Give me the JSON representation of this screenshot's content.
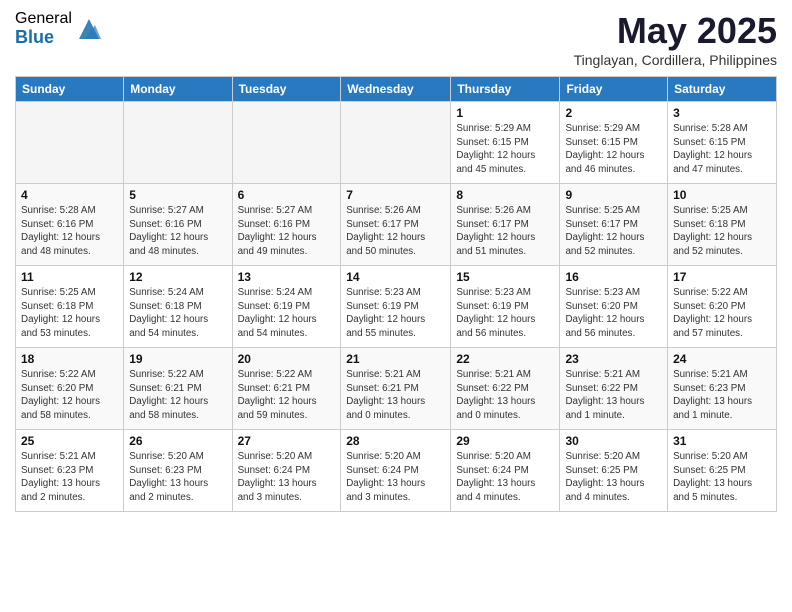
{
  "logo": {
    "general": "General",
    "blue": "Blue"
  },
  "header": {
    "month_year": "May 2025",
    "location": "Tinglayan, Cordillera, Philippines"
  },
  "weekdays": [
    "Sunday",
    "Monday",
    "Tuesday",
    "Wednesday",
    "Thursday",
    "Friday",
    "Saturday"
  ],
  "weeks": [
    [
      {
        "day": "",
        "info": ""
      },
      {
        "day": "",
        "info": ""
      },
      {
        "day": "",
        "info": ""
      },
      {
        "day": "",
        "info": ""
      },
      {
        "day": "1",
        "info": "Sunrise: 5:29 AM\nSunset: 6:15 PM\nDaylight: 12 hours\nand 45 minutes."
      },
      {
        "day": "2",
        "info": "Sunrise: 5:29 AM\nSunset: 6:15 PM\nDaylight: 12 hours\nand 46 minutes."
      },
      {
        "day": "3",
        "info": "Sunrise: 5:28 AM\nSunset: 6:15 PM\nDaylight: 12 hours\nand 47 minutes."
      }
    ],
    [
      {
        "day": "4",
        "info": "Sunrise: 5:28 AM\nSunset: 6:16 PM\nDaylight: 12 hours\nand 48 minutes."
      },
      {
        "day": "5",
        "info": "Sunrise: 5:27 AM\nSunset: 6:16 PM\nDaylight: 12 hours\nand 48 minutes."
      },
      {
        "day": "6",
        "info": "Sunrise: 5:27 AM\nSunset: 6:16 PM\nDaylight: 12 hours\nand 49 minutes."
      },
      {
        "day": "7",
        "info": "Sunrise: 5:26 AM\nSunset: 6:17 PM\nDaylight: 12 hours\nand 50 minutes."
      },
      {
        "day": "8",
        "info": "Sunrise: 5:26 AM\nSunset: 6:17 PM\nDaylight: 12 hours\nand 51 minutes."
      },
      {
        "day": "9",
        "info": "Sunrise: 5:25 AM\nSunset: 6:17 PM\nDaylight: 12 hours\nand 52 minutes."
      },
      {
        "day": "10",
        "info": "Sunrise: 5:25 AM\nSunset: 6:18 PM\nDaylight: 12 hours\nand 52 minutes."
      }
    ],
    [
      {
        "day": "11",
        "info": "Sunrise: 5:25 AM\nSunset: 6:18 PM\nDaylight: 12 hours\nand 53 minutes."
      },
      {
        "day": "12",
        "info": "Sunrise: 5:24 AM\nSunset: 6:18 PM\nDaylight: 12 hours\nand 54 minutes."
      },
      {
        "day": "13",
        "info": "Sunrise: 5:24 AM\nSunset: 6:19 PM\nDaylight: 12 hours\nand 54 minutes."
      },
      {
        "day": "14",
        "info": "Sunrise: 5:23 AM\nSunset: 6:19 PM\nDaylight: 12 hours\nand 55 minutes."
      },
      {
        "day": "15",
        "info": "Sunrise: 5:23 AM\nSunset: 6:19 PM\nDaylight: 12 hours\nand 56 minutes."
      },
      {
        "day": "16",
        "info": "Sunrise: 5:23 AM\nSunset: 6:20 PM\nDaylight: 12 hours\nand 56 minutes."
      },
      {
        "day": "17",
        "info": "Sunrise: 5:22 AM\nSunset: 6:20 PM\nDaylight: 12 hours\nand 57 minutes."
      }
    ],
    [
      {
        "day": "18",
        "info": "Sunrise: 5:22 AM\nSunset: 6:20 PM\nDaylight: 12 hours\nand 58 minutes."
      },
      {
        "day": "19",
        "info": "Sunrise: 5:22 AM\nSunset: 6:21 PM\nDaylight: 12 hours\nand 58 minutes."
      },
      {
        "day": "20",
        "info": "Sunrise: 5:22 AM\nSunset: 6:21 PM\nDaylight: 12 hours\nand 59 minutes."
      },
      {
        "day": "21",
        "info": "Sunrise: 5:21 AM\nSunset: 6:21 PM\nDaylight: 13 hours\nand 0 minutes."
      },
      {
        "day": "22",
        "info": "Sunrise: 5:21 AM\nSunset: 6:22 PM\nDaylight: 13 hours\nand 0 minutes."
      },
      {
        "day": "23",
        "info": "Sunrise: 5:21 AM\nSunset: 6:22 PM\nDaylight: 13 hours\nand 1 minute."
      },
      {
        "day": "24",
        "info": "Sunrise: 5:21 AM\nSunset: 6:23 PM\nDaylight: 13 hours\nand 1 minute."
      }
    ],
    [
      {
        "day": "25",
        "info": "Sunrise: 5:21 AM\nSunset: 6:23 PM\nDaylight: 13 hours\nand 2 minutes."
      },
      {
        "day": "26",
        "info": "Sunrise: 5:20 AM\nSunset: 6:23 PM\nDaylight: 13 hours\nand 2 minutes."
      },
      {
        "day": "27",
        "info": "Sunrise: 5:20 AM\nSunset: 6:24 PM\nDaylight: 13 hours\nand 3 minutes."
      },
      {
        "day": "28",
        "info": "Sunrise: 5:20 AM\nSunset: 6:24 PM\nDaylight: 13 hours\nand 3 minutes."
      },
      {
        "day": "29",
        "info": "Sunrise: 5:20 AM\nSunset: 6:24 PM\nDaylight: 13 hours\nand 4 minutes."
      },
      {
        "day": "30",
        "info": "Sunrise: 5:20 AM\nSunset: 6:25 PM\nDaylight: 13 hours\nand 4 minutes."
      },
      {
        "day": "31",
        "info": "Sunrise: 5:20 AM\nSunset: 6:25 PM\nDaylight: 13 hours\nand 5 minutes."
      }
    ]
  ]
}
